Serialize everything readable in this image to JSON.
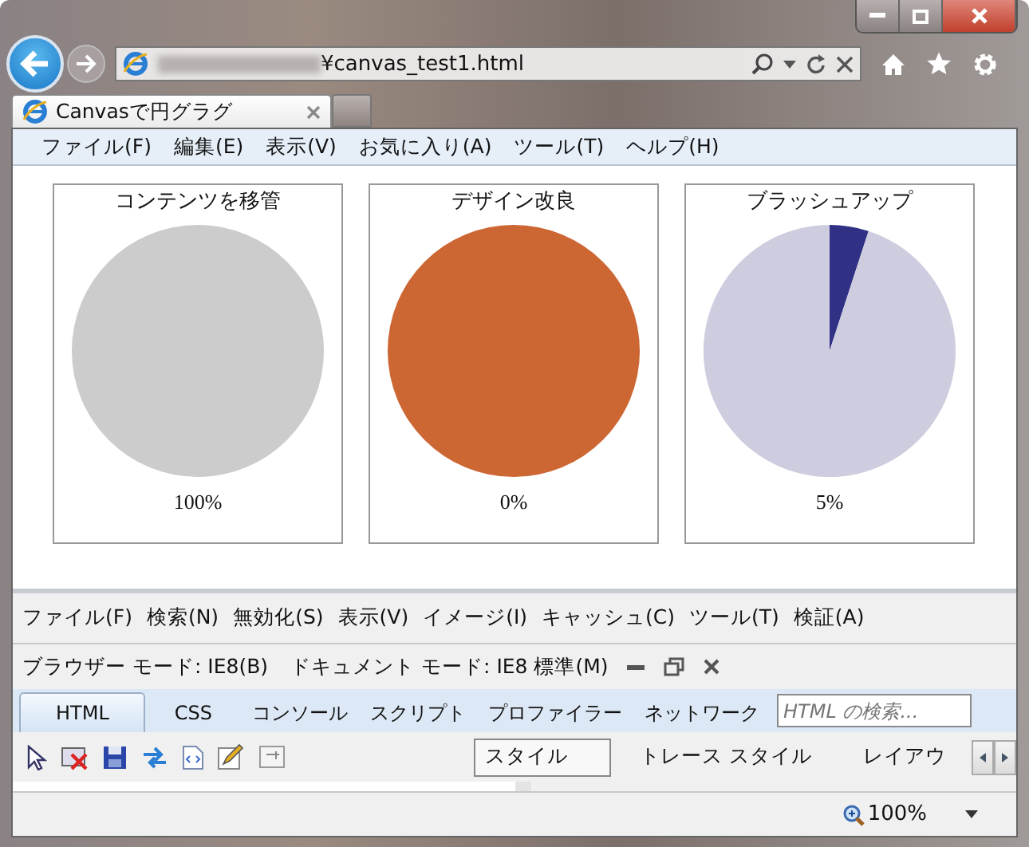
{
  "window": {
    "address": "¥canvas_test1.html"
  },
  "tabs": [
    {
      "label": "Canvasで円グラグ",
      "selected": true
    }
  ],
  "menu_bar": [
    "ファイル(F)",
    "編集(E)",
    "表示(V)",
    "お気に入り(A)",
    "ツール(T)",
    "ヘルプ(H)"
  ],
  "cards": [
    {
      "title": "コンテンツを移管",
      "percent": "100%",
      "color": "#cccccc"
    },
    {
      "title": "デザイン改良",
      "percent": "0%",
      "color": "#cc6633"
    },
    {
      "title": "ブラッシュアップ",
      "percent": "5%",
      "chart_data": {
        "type": "pie",
        "values": [
          5,
          95
        ],
        "colors": [
          "#303085",
          "#cecddf"
        ]
      }
    }
  ],
  "devtools": {
    "menu": [
      "ファイル(F)",
      "検索(N)",
      "無効化(S)",
      "表示(V)",
      "イメージ(I)",
      "キャッシュ(C)",
      "ツール(T)",
      "検証(A)"
    ],
    "browser_mode": "ブラウザー モード: IE8(B)",
    "document_mode": "ドキュメント モード: IE8 標準(M)",
    "tabs": [
      {
        "label": "HTML",
        "selected": true
      },
      {
        "label": "CSS",
        "selected": false
      },
      {
        "label": "コンソール",
        "selected": false
      },
      {
        "label": "スクリプト",
        "selected": false
      },
      {
        "label": "プロファイラー",
        "selected": false
      },
      {
        "label": "ネットワーク",
        "selected": false
      }
    ],
    "search": {
      "placeholder": "HTML の検索..."
    },
    "side_tabs": [
      {
        "label": "スタイル",
        "selected": true
      },
      {
        "label": "トレース スタイル",
        "selected": false
      },
      {
        "label": "レイアウ",
        "selected": false
      }
    ]
  },
  "status_bar": {
    "zoom": "100%"
  }
}
